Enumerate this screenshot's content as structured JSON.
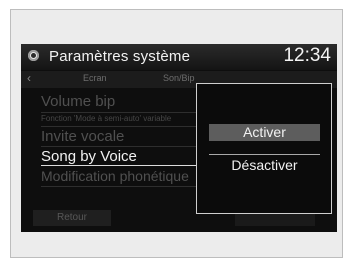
{
  "header": {
    "title": "Paramètres système",
    "time": "12:34"
  },
  "tabs": [
    {
      "label": "Ecran"
    },
    {
      "label": "Son/Bip"
    }
  ],
  "menu": {
    "items": [
      {
        "label": "Volume bip"
      },
      {
        "label": "Fonction 'Mode à semi-auto' variable"
      },
      {
        "label": "Invite vocale"
      },
      {
        "label": "Song by Voice"
      },
      {
        "label": "Modification phonétique"
      }
    ]
  },
  "footer": {
    "back_label": "Retour"
  },
  "popup": {
    "options": [
      {
        "label": "Activer",
        "selected": true
      },
      {
        "label": "Désactiver",
        "selected": false
      }
    ]
  },
  "colors": {
    "screen_bg": "#0e0e0e",
    "highlight": "#5d5d5d",
    "text_active": "#f1f1f1",
    "text_dim": "#505050"
  }
}
